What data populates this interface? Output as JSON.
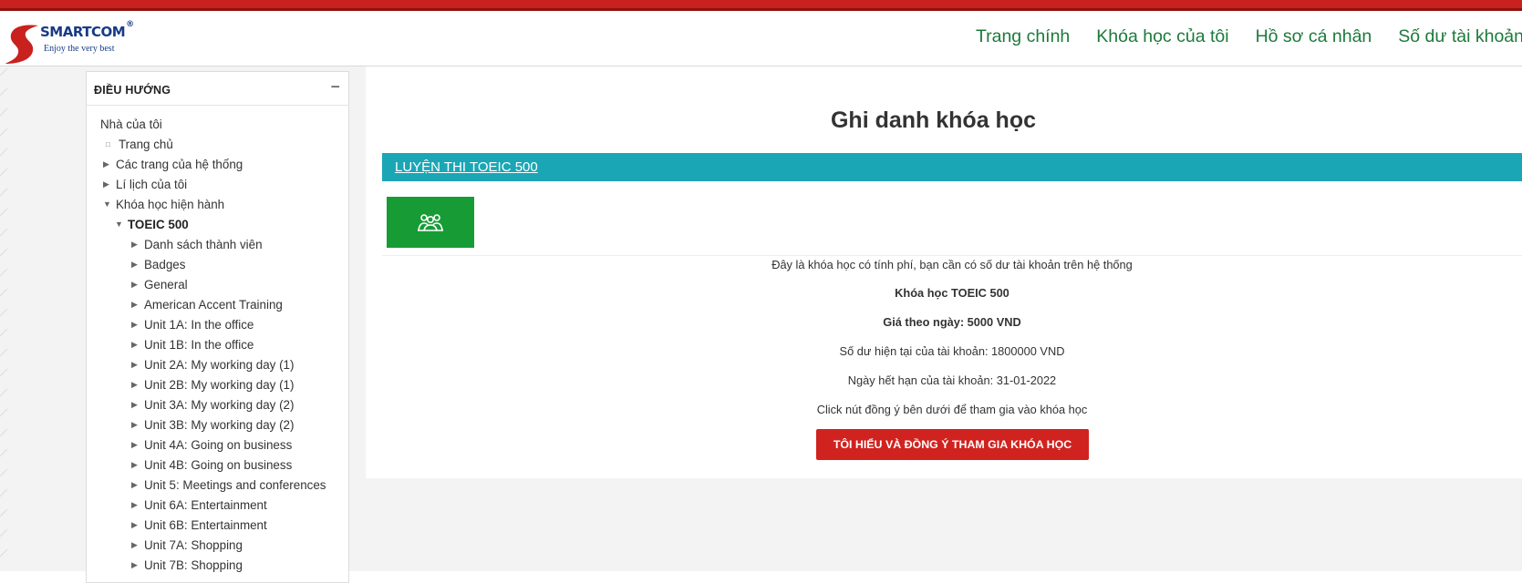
{
  "header": {
    "logo_text": "SMARTCOM",
    "logo_reg": "®",
    "logo_tagline": "Enjoy the very best",
    "nav": [
      "Trang chính",
      "Khóa học của tôi",
      "Hồ sơ cá nhân",
      "Số dư tài khoản"
    ]
  },
  "sidebar": {
    "title": "ĐIỀU HƯỚNG",
    "collapse_icon": "−",
    "items": [
      {
        "label": "Nhà của tôi"
      },
      {
        "label": "Trang chủ"
      },
      {
        "label": "Các trang của hệ thống"
      },
      {
        "label": "Lí lịch của tôi"
      },
      {
        "label": "Khóa học hiện hành"
      },
      {
        "label": "TOEIC 500"
      },
      {
        "label": "Danh sách thành viên"
      },
      {
        "label": "Badges"
      },
      {
        "label": "General"
      },
      {
        "label": "American Accent Training"
      },
      {
        "label": "Unit 1A: In the office"
      },
      {
        "label": "Unit 1B: In the office"
      },
      {
        "label": "Unit 2A: My working day (1)"
      },
      {
        "label": "Unit 2B: My working day (1)"
      },
      {
        "label": "Unit 3A: My working day (2)"
      },
      {
        "label": "Unit 3B: My working day (2)"
      },
      {
        "label": "Unit 4A: Going on business"
      },
      {
        "label": "Unit 4B: Going on business"
      },
      {
        "label": "Unit 5: Meetings and conferences"
      },
      {
        "label": "Unit 6A: Entertainment"
      },
      {
        "label": "Unit 6B: Entertainment"
      },
      {
        "label": "Unit 7A: Shopping"
      },
      {
        "label": "Unit 7B: Shopping"
      }
    ]
  },
  "main": {
    "title": "Ghi danh khóa học",
    "course_name": "LUYỆN THI TOEIC 500",
    "enrol_icon": "self-enrol-icon",
    "lines": {
      "notice": "Đây là khóa học có tính phí, bạn cần có số dư tài khoản trên hệ thống",
      "course": "Khóa học TOEIC 500",
      "price": "Giá theo ngày: 5000 VND",
      "balance": "Số dư hiện tại của tài khoản: 1800000 VND",
      "expiry": "Ngày hết hạn của tài khoản: 31-01-2022",
      "instruction": "Click nút đồng ý bên dưới để tham gia vào khóa học"
    },
    "agree_button": "TÔI HIỂU VÀ ĐỒNG Ý THAM GIA KHÓA HỌC"
  },
  "colors": {
    "brand_red": "#c8211e",
    "nav_green": "#1c7a3a",
    "course_bar": "#1ba6b5",
    "enrol_green": "#179c35",
    "button_red": "#d0231f"
  }
}
